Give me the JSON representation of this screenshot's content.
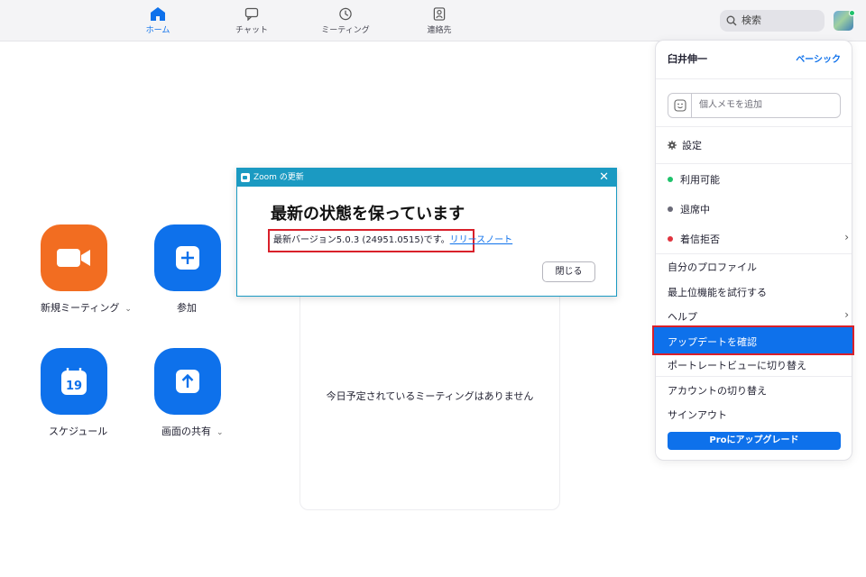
{
  "nav": {
    "items": [
      {
        "label": "ホーム",
        "icon": "home-icon"
      },
      {
        "label": "チャット",
        "icon": "chat-icon"
      },
      {
        "label": "ミーティング",
        "icon": "clock-icon"
      },
      {
        "label": "連絡先",
        "icon": "contact-icon"
      }
    ],
    "search_placeholder": "検索"
  },
  "tiles": {
    "new_meeting": "新規ミーティング",
    "join": "参加",
    "schedule": "スケジュール",
    "calendar_day": "19",
    "share_screen": "画面の共有"
  },
  "meetings": {
    "empty_text": "今日予定されているミーティングはありません"
  },
  "dialog": {
    "title": "Zoom の更新",
    "close_symbol": "✕",
    "heading": "最新の状態を保っています",
    "version_text": "最新バージョン5.0.3 (24951.0515)です。",
    "release_notes_link": "リリースノート",
    "close_button": "閉じる"
  },
  "menu": {
    "user_name": "臼井伸一",
    "plan": "ベーシック",
    "memo_placeholder": "個人メモを追加",
    "settings": "設定",
    "status": [
      {
        "label": "利用可能",
        "color": "#1fc26b"
      },
      {
        "label": "退席中",
        "color": "#6a6a78"
      },
      {
        "label": "着信拒否",
        "color": "#e0343f"
      }
    ],
    "my_profile": "自分のプロファイル",
    "try_top_features": "最上位機能を試行する",
    "help": "ヘルプ",
    "check_updates": "アップデートを確認",
    "portrait_view": "ポートレートビューに切り替え",
    "switch_account": "アカウントの切り替え",
    "sign_out": "サインアウト",
    "upgrade": "Proにアップグレード"
  },
  "colors": {
    "accent": "#0e71eb",
    "new_meeting_tile": "#f26d21",
    "highlight_border": "#d9202a",
    "dialog_titlebar": "#1b9ac2"
  }
}
